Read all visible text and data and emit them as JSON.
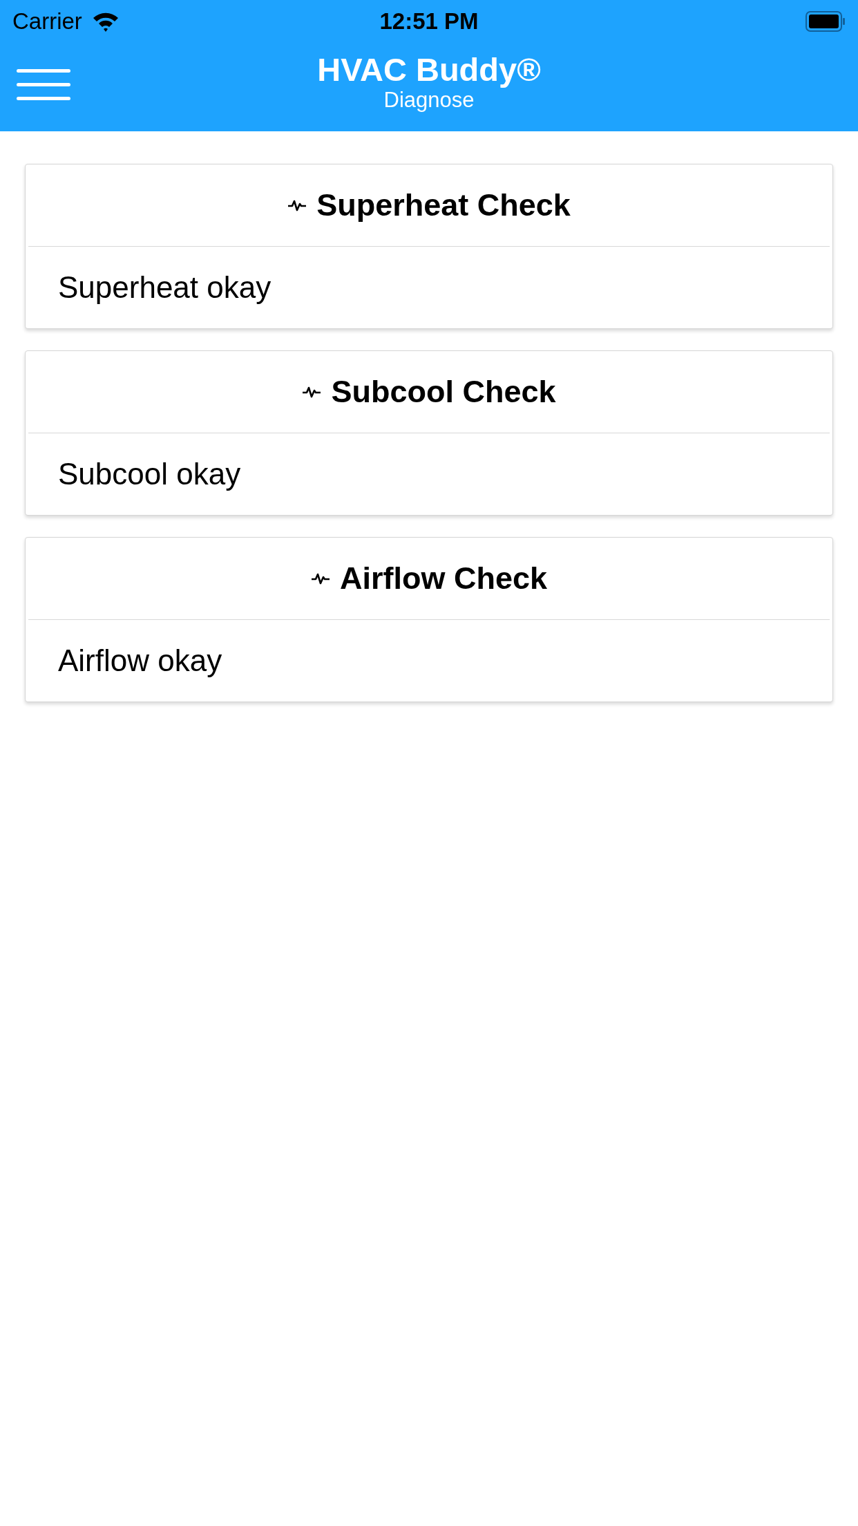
{
  "status_bar": {
    "carrier": "Carrier",
    "time": "12:51 PM"
  },
  "header": {
    "title": "HVAC Buddy®",
    "subtitle": "Diagnose"
  },
  "checks": [
    {
      "title": "Superheat Check",
      "result": "Superheat okay"
    },
    {
      "title": "Subcool Check",
      "result": "Subcool okay"
    },
    {
      "title": "Airflow Check",
      "result": "Airflow okay"
    }
  ]
}
